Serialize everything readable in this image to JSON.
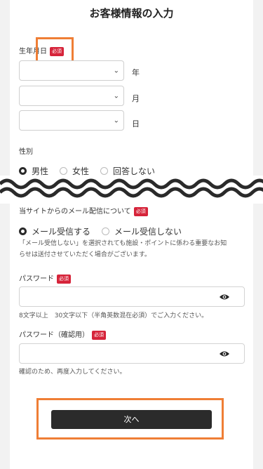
{
  "page": {
    "title": "お客様情報の入力"
  },
  "birthdate": {
    "label": "生年月日",
    "required_badge": "必須",
    "year_unit": "年",
    "month_unit": "月",
    "day_unit": "日"
  },
  "gender": {
    "label": "性別",
    "selected": "男性",
    "options": [
      "男性",
      "女性",
      "回答しない"
    ]
  },
  "email_opt": {
    "label": "当サイトからのメール配信について",
    "required_badge": "必須",
    "selected": "メール受信する",
    "options": [
      "メール受信する",
      "メール受信しない"
    ],
    "note_line1": "「メール受信しない」を選択されても施設・ポイントに係わる重要なお知",
    "note_line2": "らせは送付させていただく場合がございます。"
  },
  "password": {
    "label": "パスワード",
    "required_badge": "必須",
    "hint": "8文字以上　30文字以下（半角英数混在必須）でご入力ください。"
  },
  "password_confirm": {
    "label": "パスワード（確認用）",
    "required_badge": "必須",
    "hint": "確認のため、再度入力してください。"
  },
  "actions": {
    "next_label": "次へ"
  },
  "colors": {
    "badge": "#d6243a",
    "highlight": "#ef7e35",
    "button": "#2b2b2b"
  },
  "icons": {
    "select": "chevron-down-icon",
    "password_toggle": "eye-icon"
  }
}
